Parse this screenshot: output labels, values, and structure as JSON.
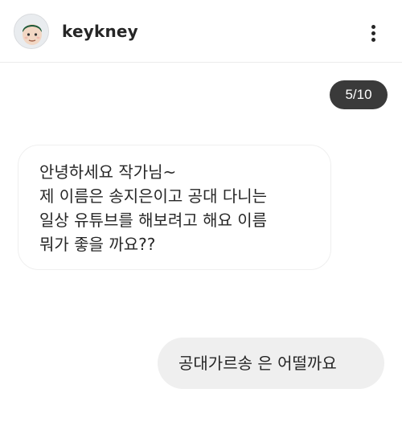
{
  "header": {
    "username": "keykney",
    "avatar_icon": "profile-avatar-face-icon",
    "more_icon": "more-vertical-icon"
  },
  "page_indicator": "5/10",
  "messages": [
    {
      "direction": "incoming",
      "lines": [
        "안녕하세요 작가님~",
        "제 이름은 송지은이고 공대 다니는",
        "일상 유튜브를 해보려고 해요 이름",
        "뭐가 좋을 까요??"
      ]
    },
    {
      "direction": "outgoing",
      "lines": [
        "공대가르송 은 어떨까요"
      ]
    }
  ],
  "colors": {
    "background": "#ffffff",
    "text": "#262626",
    "badge_bg": "#3a3a3a",
    "outgoing_bubble": "#efefef",
    "incoming_border": "#efefef",
    "avatar_face": "#f2d7c4",
    "avatar_hair": "#1f5a3a"
  }
}
